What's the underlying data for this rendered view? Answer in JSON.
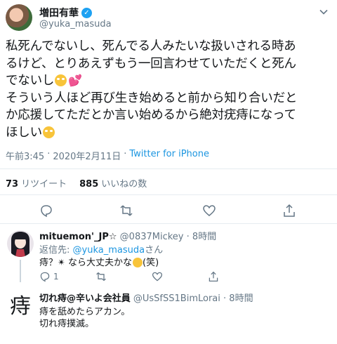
{
  "tweet": {
    "display_name": "増田有華",
    "handle": "@yuka_masuda",
    "verified_icon": "✓",
    "text_lines": [
      "私死んでないし、死んでる人みたいな扱いされる時あ",
      "るけど、とりあえずもう一回言わせていただくと死ん",
      "でないし",
      "そういう人ほど再び生き始めると前から知り合いだと",
      "か応援してただとか言い始めるから絶対疣痔になって",
      "ほしい"
    ],
    "time": "午前3:45",
    "separator": "·",
    "date": "2020年2月11日",
    "source": "Twitter for iPhone",
    "retweet_count": "73",
    "retweet_label": "リツイート",
    "like_count": "885",
    "like_label": "いいねの数"
  },
  "replies": [
    {
      "name": "mituemon'_JP☆",
      "handle": "@0837Mickey",
      "time": "8時間",
      "reply_prefix": "返信先:",
      "reply_to": "@yuka_masuda",
      "reply_suffix": "さん",
      "text": "痔？✴ なら大丈夫かな",
      "text_tail": "(笑)",
      "reply_count": "1"
    },
    {
      "name": "切れ痔@辛いよ会社員",
      "handle": "@UsSfSS1BimLorai",
      "time": "8時間",
      "avatar_glyph": "痔",
      "line1": "痔を舐めたらアカン。",
      "line2": "切れ痔撲滅。"
    }
  ],
  "colors": {
    "accent": "#1b95e0",
    "muted": "#657786",
    "divider": "#e6ecf0"
  }
}
